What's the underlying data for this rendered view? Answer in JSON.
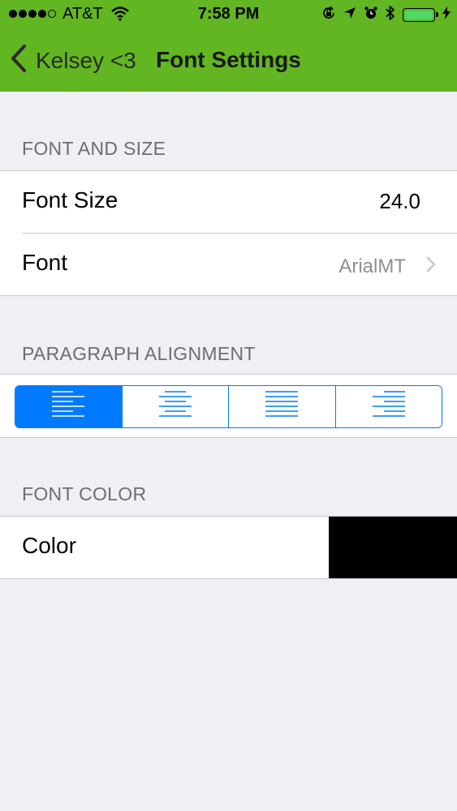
{
  "status_bar": {
    "signal_bars": 5,
    "signal_filled": 4,
    "carrier": "AT&T",
    "time": "7:58 PM",
    "icons": [
      "wifi-icon",
      "rotation-lock-icon",
      "location-icon",
      "alarm-icon",
      "bluetooth-icon",
      "battery-icon",
      "charging-icon"
    ],
    "battery_level": 1.0
  },
  "nav": {
    "back_label": "Kelsey <3",
    "title": "Font Settings"
  },
  "sections": {
    "font_and_size": {
      "header": "FONT AND SIZE",
      "font_size_label": "Font Size",
      "font_size_value": "24.0",
      "font_label": "Font",
      "font_value": "ArialMT"
    },
    "paragraph_alignment": {
      "header": "PARAGRAPH ALIGNMENT",
      "options": [
        "align-left-icon",
        "align-center-icon",
        "align-justify-icon",
        "align-right-icon"
      ],
      "selected_index": 0
    },
    "font_color": {
      "header": "FONT COLOR",
      "color_label": "Color",
      "color_value": "#000000"
    }
  },
  "colors": {
    "header_green": "#62b622",
    "accent_blue": "#007aff",
    "background": "#efeff4",
    "battery_green": "#4cd964"
  }
}
